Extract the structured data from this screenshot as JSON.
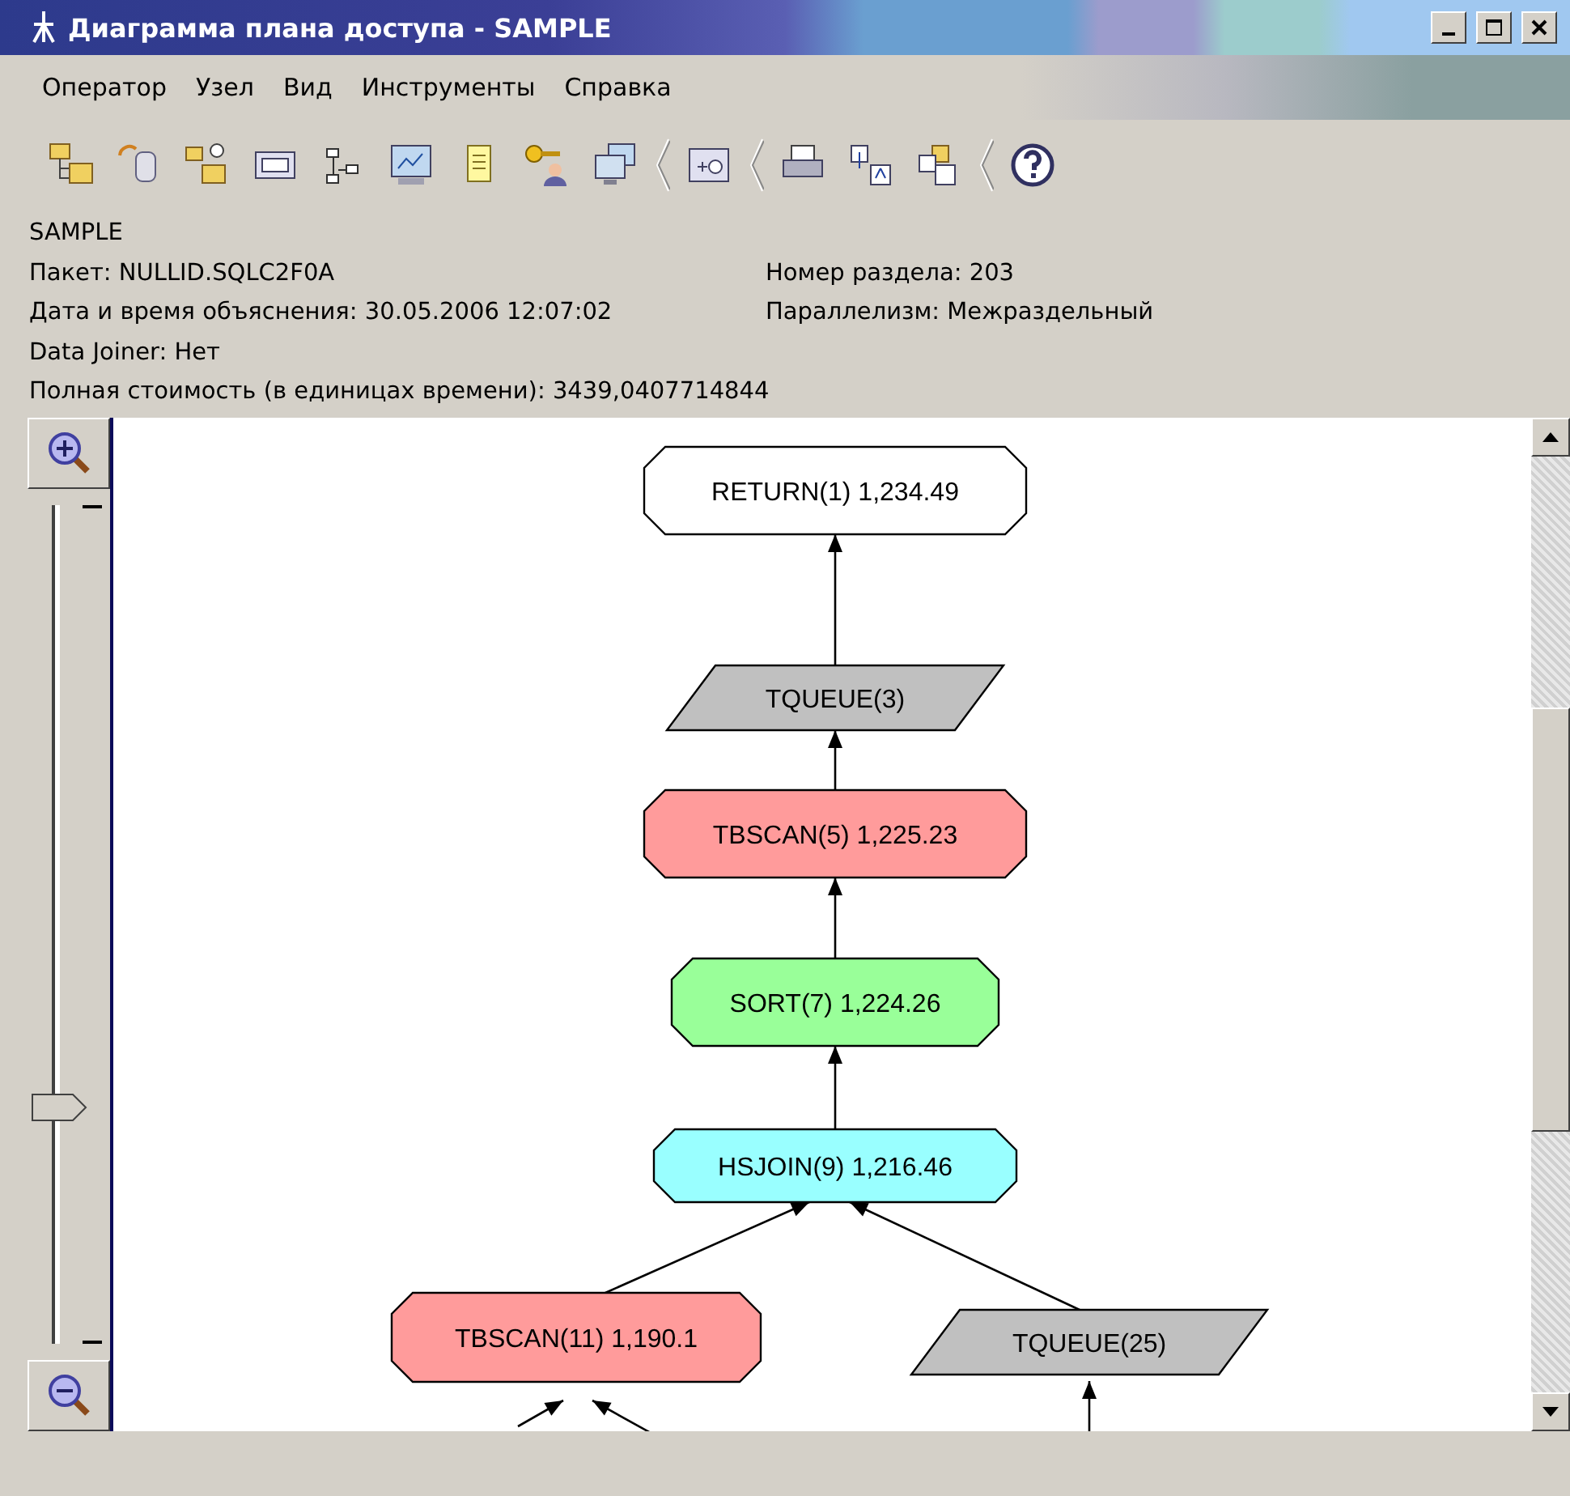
{
  "window": {
    "title": "Диаграмма плана доступа - SAMPLE"
  },
  "menu": [
    "Оператор",
    "Узел",
    "Вид",
    "Инструменты",
    "Справка"
  ],
  "info": {
    "heading": "SAMPLE",
    "rows": [
      {
        "left": "Пакет: NULLID.SQLC2F0A",
        "right": "Номер раздела: 203"
      },
      {
        "left": "Дата и время объяснения: 30.05.2006 12:07:02",
        "right": "Параллелизм: Межраздельный"
      },
      {
        "left": "Data Joiner: Нет"
      },
      {
        "left": "Полная стоимость (в единицах времени): 3439,0407714844"
      }
    ]
  },
  "zoom": {
    "level": 0.28
  },
  "plan": {
    "kind": "operator",
    "label": "RETURN(1) 1,234.49",
    "color": "#ffffff",
    "children": [
      {
        "kind": "queue",
        "label": "TQUEUE(3)",
        "color": "#c0c0c0",
        "children": [
          {
            "kind": "operator",
            "label": "TBSCAN(5) 1,225.23",
            "color": "#ff9b9b",
            "children": [
              {
                "kind": "operator",
                "label": "SORT(7) 1,224.26",
                "color": "#99ff99",
                "children": [
                  {
                    "kind": "operator",
                    "label": "HSJOIN(9) 1,216.46",
                    "color": "#99ffff",
                    "children": [
                      {
                        "kind": "operator",
                        "label": "TBSCAN(11) 1,190.1",
                        "color": "#ff9b9b",
                        "children": [
                          {
                            "kind": "offscreen"
                          },
                          {
                            "kind": "offscreen"
                          }
                        ]
                      },
                      {
                        "kind": "queue",
                        "label": "TQUEUE(25)",
                        "color": "#c0c0c0",
                        "children": [
                          {
                            "kind": "offscreen"
                          }
                        ]
                      }
                    ]
                  }
                ]
              }
            ]
          }
        ]
      }
    ]
  }
}
